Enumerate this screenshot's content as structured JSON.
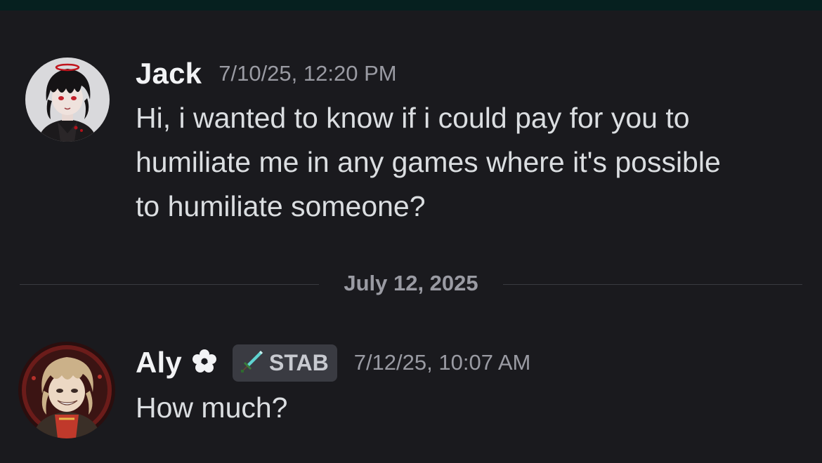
{
  "messages": [
    {
      "username": "Jack",
      "timestamp": "7/10/25, 12:20 PM",
      "lines": [
        "Hi, i wanted to know if i could pay for you to",
        "humiliate me in any games where it's possible",
        "to humiliate someone?"
      ]
    },
    {
      "username": "Aly",
      "role_icon": "flower-icon",
      "tag": {
        "icon": "sword-icon",
        "label": "STAB"
      },
      "timestamp": "7/12/25, 10:07 AM",
      "lines": [
        "How much?"
      ]
    }
  ],
  "date_divider": {
    "label": "July 12, 2025"
  },
  "colors": {
    "background": "#1a1a1e",
    "top_bar": "#06201f",
    "username": "#f2f3f5",
    "timestamp": "#9a9ba3",
    "message_text": "#dbdee1",
    "tag_background": "#3a3b42",
    "tag_sword": "#4ec9c9"
  }
}
